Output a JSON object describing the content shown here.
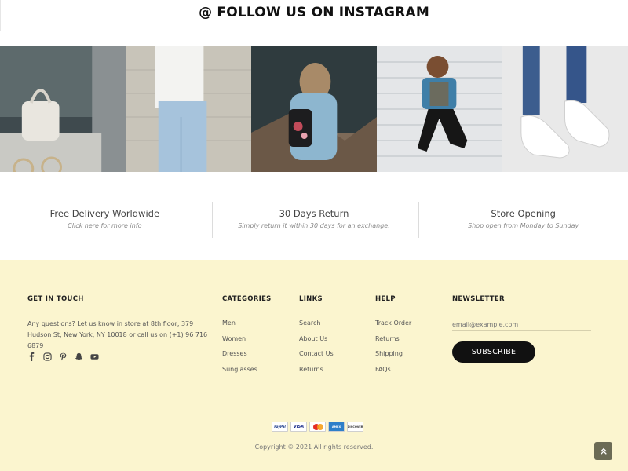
{
  "instagram": {
    "title": "@ FOLLOW US ON INSTAGRAM"
  },
  "gallery": {
    "images": [
      {
        "name": "white handbag and sunglasses"
      },
      {
        "name": "person in ripped jeans"
      },
      {
        "name": "woman with floral backpack on pier"
      },
      {
        "name": "woman jumping in denim jacket"
      },
      {
        "name": "white sneakers"
      }
    ]
  },
  "features": [
    {
      "title": "Free Delivery Worldwide",
      "sub": "Click here for more info"
    },
    {
      "title": "30 Days Return",
      "sub": "Simply return it within 30 days for an exchange."
    },
    {
      "title": "Store Opening",
      "sub": "Shop open from Monday to Sunday"
    }
  ],
  "footer": {
    "get_in_touch": {
      "title": "GET IN TOUCH",
      "text": "Any questions? Let us know in store at 8th floor, 379 Hudson St, New York, NY 10018 or call us on (+1) 96 716 6879",
      "socials": [
        "facebook-icon",
        "instagram-icon",
        "pinterest-icon",
        "snapchat-icon",
        "youtube-icon"
      ]
    },
    "categories": {
      "title": "CATEGORIES",
      "items": [
        "Men",
        "Women",
        "Dresses",
        "Sunglasses"
      ]
    },
    "links": {
      "title": "LINKS",
      "items": [
        "Search",
        "About Us",
        "Contact Us",
        "Returns"
      ]
    },
    "help": {
      "title": "HELP",
      "items": [
        "Track Order",
        "Returns",
        "Shipping",
        "FAQs"
      ]
    },
    "newsletter": {
      "title": "NEWSLETTER",
      "placeholder": "email@example.com",
      "button": "SUBSCRIBE"
    },
    "payments": [
      "PayPal",
      "VISA",
      "MasterCard",
      "AMEX",
      "DISCOVER"
    ],
    "copyright": "Copyright © 2021 All rights reserved."
  },
  "colors": {
    "footer_bg": "#fbf5cf",
    "button_bg": "#111111",
    "scroll_top_bg": "#6b6b55"
  }
}
